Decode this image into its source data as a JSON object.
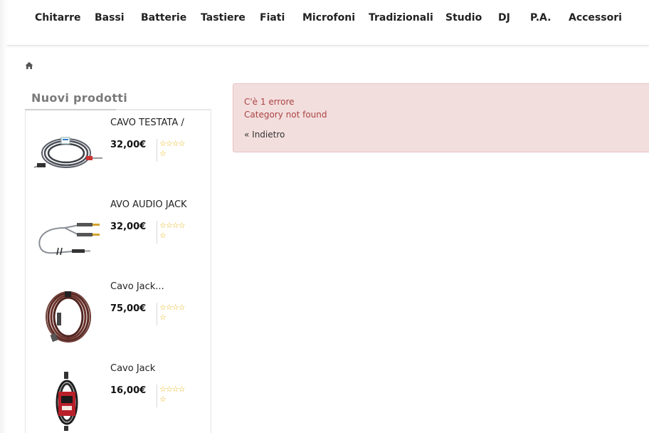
{
  "nav": {
    "items": [
      "Chitarre",
      "Bassi",
      "Batterie",
      "Tastiere",
      "Fiati",
      "Microfoni",
      "Tradizionali",
      "Studio",
      "DJ",
      "P.A.",
      "Accessori"
    ]
  },
  "breadcrumb": {
    "home_icon": "home-icon"
  },
  "sidebar": {
    "title": "Nuovi prodotti",
    "products": [
      {
        "name": "CAVO TESTATA /",
        "price": "32,00€",
        "stars": "☆☆☆☆",
        "stars2": "☆"
      },
      {
        "name": "AVO AUDIO JACK",
        "price": "32,00€",
        "stars": "☆☆☆☆",
        "stars2": "☆"
      },
      {
        "name": "Cavo Jack...",
        "price": "75,00€",
        "stars": "☆☆☆☆",
        "stars2": "☆"
      },
      {
        "name": "Cavo Jack",
        "price": "16,00€",
        "stars": "☆☆☆☆",
        "stars2": "☆"
      }
    ]
  },
  "alert": {
    "title": "C'è 1 errore",
    "message": "Category not found",
    "back_link": "« Indietro"
  },
  "colors": {
    "alert_bg": "#f3dede",
    "alert_text": "#a94442",
    "star": "#e8b30e"
  }
}
